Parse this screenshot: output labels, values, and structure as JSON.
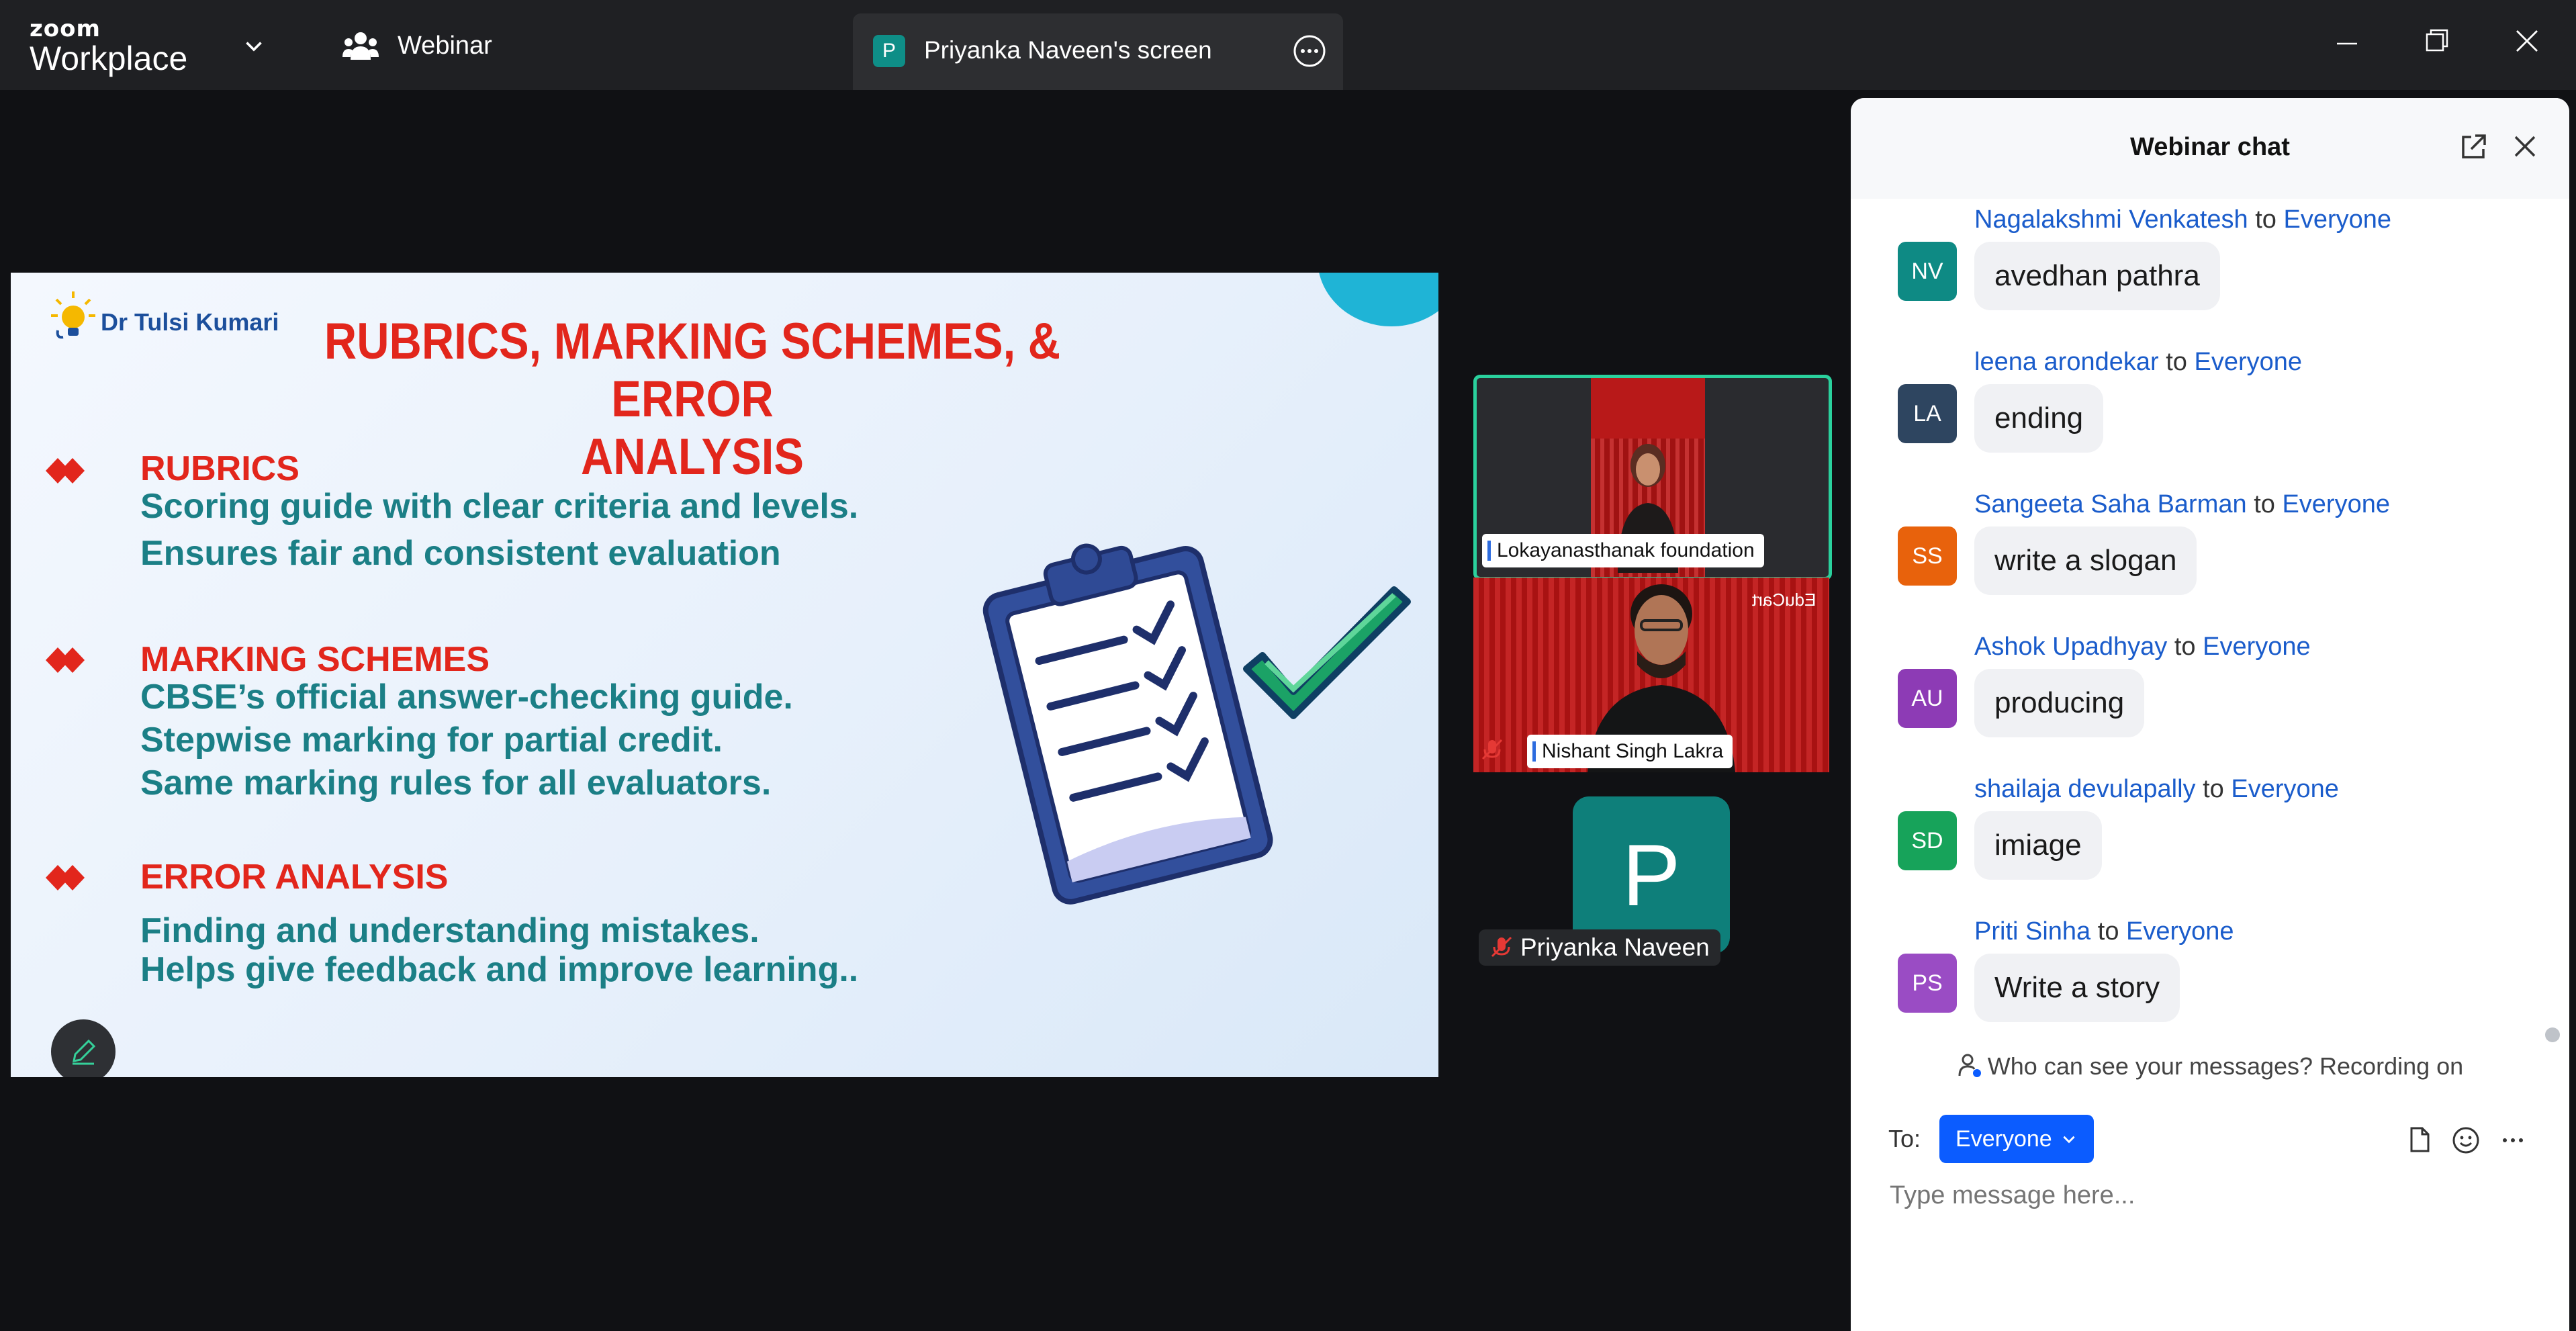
{
  "app": {
    "logo_top": "zoom",
    "logo_bottom": "Workplace"
  },
  "topbar": {
    "webinar_label": "Webinar",
    "share_tab": {
      "badge": "P",
      "label": "Priyanka Naveen's screen"
    }
  },
  "slide": {
    "author": "Dr Tulsi Kumari",
    "title_line1": "RUBRICS, MARKING SCHEMES, & ERROR",
    "title_line2": "ANALYSIS",
    "sections": [
      {
        "heading": "RUBRICS",
        "lines": [
          "Scoring guide with clear criteria and levels.",
          "Ensures fair and consistent evaluation"
        ]
      },
      {
        "heading": "MARKING SCHEMES",
        "lines": [
          "CBSE’s official answer-checking guide.",
          "Stepwise marking for partial credit.",
          "Same marking rules for all evaluators."
        ]
      },
      {
        "heading": "ERROR ANALYSIS",
        "lines": [
          "Finding and understanding mistakes.",
          "Helps give feedback and improve learning.."
        ]
      }
    ]
  },
  "participants": {
    "tile1": {
      "name": "Lokayanasthanak foundation"
    },
    "tile2": {
      "name": "Nishant Singh Lakra",
      "overlay": "EduCart"
    },
    "tile3": {
      "initial": "P",
      "name": "Priyanka Naveen"
    }
  },
  "chat": {
    "title": "Webinar chat",
    "to_word": "to",
    "messages": [
      {
        "initials": "NV",
        "color": "#0e8a84",
        "sender": "Nagalakshmi Venkatesh",
        "recipient": "Everyone",
        "text": "avedhan pathra"
      },
      {
        "initials": "LA",
        "color": "#2e4560",
        "sender": "leena arondekar",
        "recipient": "Everyone",
        "text": "ending"
      },
      {
        "initials": "SS",
        "color": "#e8620c",
        "sender": "Sangeeta Saha Barman",
        "recipient": "Everyone",
        "text": "write a slogan"
      },
      {
        "initials": "AU",
        "color": "#8d3bb5",
        "sender": "Ashok Upadhyay",
        "recipient": "Everyone",
        "text": "producing"
      },
      {
        "initials": "SD",
        "color": "#17a35a",
        "sender": "shailaja devulapally",
        "recipient": "Everyone",
        "text": "imiage"
      },
      {
        "initials": "PS",
        "color": "#9a4cc4",
        "sender": "Priti Sinha",
        "recipient": "Everyone",
        "text": "Write a story"
      }
    ],
    "privacy_notice": "Who can see your messages? Recording on",
    "to_label": "To:",
    "recipient_select": "Everyone",
    "input_placeholder": "Type message here..."
  },
  "colors": {
    "accent_blue": "#0b5cff",
    "active_speaker": "#2ad19d",
    "slide_red": "#e2261c",
    "slide_teal": "#1b7f86"
  }
}
